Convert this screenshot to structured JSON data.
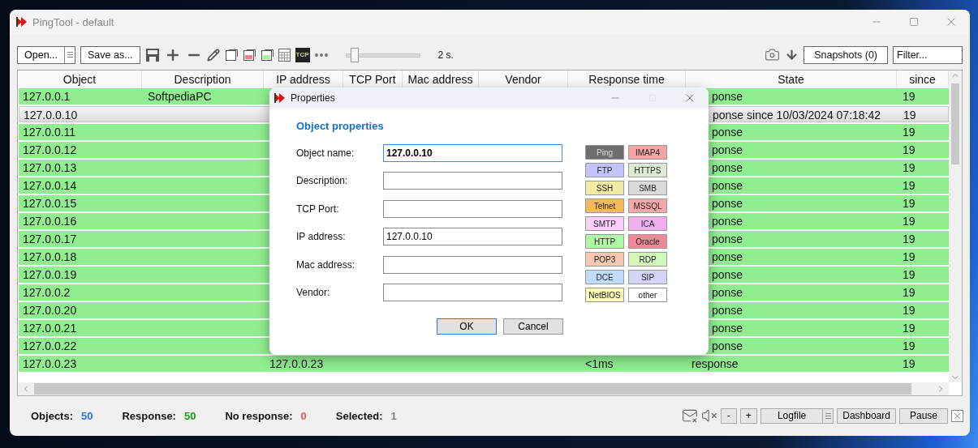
{
  "window": {
    "title": "PingTool - default"
  },
  "toolbar": {
    "open_button": "Open...",
    "save_as_button": "Save as...",
    "tcp_badge": "TCP",
    "interval": {
      "level": 0.12
    },
    "interval_reading": "2 s.",
    "snapshots_button": "Snapshots (0)",
    "filter": {
      "placeholder": "Filter..."
    }
  },
  "table": {
    "columns": [
      "Object",
      "Description",
      "IP address",
      "TCP Port",
      "Mac address",
      "Vendor",
      "Response time",
      "State",
      "since"
    ],
    "rows": [
      {
        "object": "127.0.0.1",
        "description": "SoftpediaPC",
        "state": "ponse",
        "since": "19",
        "selected": false
      },
      {
        "object": "127.0.0.10",
        "state": "ponse since 10/03/2024 07:18:42",
        "since": "19",
        "selected": true
      },
      {
        "object": "127.0.0.11",
        "state": "ponse",
        "since": "19",
        "selected": false
      },
      {
        "object": "127.0.0.12",
        "state": "ponse",
        "since": "19",
        "selected": false
      },
      {
        "object": "127.0.0.13",
        "state": "ponse",
        "since": "19",
        "selected": false
      },
      {
        "object": "127.0.0.14",
        "state": "ponse",
        "since": "19",
        "selected": false
      },
      {
        "object": "127.0.0.15",
        "state": "ponse",
        "since": "19",
        "selected": false
      },
      {
        "object": "127.0.0.16",
        "state": "ponse",
        "since": "19",
        "selected": false
      },
      {
        "object": "127.0.0.17",
        "state": "ponse",
        "since": "19",
        "selected": false
      },
      {
        "object": "127.0.0.18",
        "state": "ponse",
        "since": "19",
        "selected": false
      },
      {
        "object": "127.0.0.19",
        "state": "ponse",
        "since": "19",
        "selected": false
      },
      {
        "object": "127.0.0.2",
        "state": "ponse",
        "since": "19",
        "selected": false
      },
      {
        "object": "127.0.0.20",
        "state": "ponse",
        "since": "19",
        "selected": false
      },
      {
        "object": "127.0.0.21",
        "state": "ponse",
        "since": "19",
        "selected": false
      },
      {
        "object": "127.0.0.22",
        "state": "ponse",
        "since": "19",
        "selected": false
      },
      {
        "object": "127.0.0.23",
        "ip_address": "127.0.0.23",
        "response_time": "<1ms",
        "state": "response",
        "since": "19",
        "selected": false
      }
    ]
  },
  "status_bar": {
    "counts": [
      {
        "label": "Objects:",
        "value": "50",
        "color": "#2f6fe0"
      },
      {
        "label": "Response:",
        "value": "50",
        "color": "#1a9a1a"
      },
      {
        "label": "No response:",
        "value": "0",
        "color": "#f05050"
      },
      {
        "label": "Selected:",
        "value": "1",
        "color": "#808080"
      }
    ],
    "buttons": [
      "-",
      "+"
    ],
    "logfile_button": "Logfile",
    "dashboard_button": "Dashboard",
    "pause_button": "Pause"
  },
  "dialog": {
    "title": "Properties",
    "heading": "Object properties",
    "fields": [
      {
        "label": "Object name:",
        "value": "127.0.0.10",
        "focused": true
      },
      {
        "label": "Description:",
        "focused": false
      },
      {
        "label": "TCP Port:",
        "focused": false
      },
      {
        "label": "IP address:",
        "value": "127.0.0.10",
        "focused": false
      },
      {
        "label": "Mac address:",
        "focused": false
      },
      {
        "label": "Vendor:",
        "focused": false
      }
    ],
    "protocols": [
      {
        "label": "Ping",
        "color": "#6e6e6e"
      },
      {
        "label": "IMAP4",
        "color": "#f5a3a3"
      },
      {
        "label": "FTP",
        "color": "#c4c4fc"
      },
      {
        "label": "HTTPS",
        "color": "#dcecd4"
      },
      {
        "label": "SSH",
        "color": "#f0eca4"
      },
      {
        "label": "SMB",
        "color": "#dadada"
      },
      {
        "label": "Telnet",
        "color": "#f8b860"
      },
      {
        "label": "MSSQL",
        "color": "#f6a8a8"
      },
      {
        "label": "SMTP",
        "color": "#fcd0fc"
      },
      {
        "label": "ICA",
        "color": "#f0b0f0"
      },
      {
        "label": "HTTP",
        "color": "#b0f8a8"
      },
      {
        "label": "Oracle",
        "color": "#f08898"
      },
      {
        "label": "POP3",
        "color": "#f8c8b0"
      },
      {
        "label": "RDP",
        "color": "#d4f8bc"
      },
      {
        "label": "DCE",
        "color": "#c0dcfc"
      },
      {
        "label": "SIP",
        "color": "#d4d4f8"
      },
      {
        "label": "NetBIOS",
        "color": "#fcf8b8"
      },
      {
        "label": "other",
        "color": "#ffffff"
      }
    ],
    "buttons": [
      "OK",
      "Cancel"
    ]
  }
}
